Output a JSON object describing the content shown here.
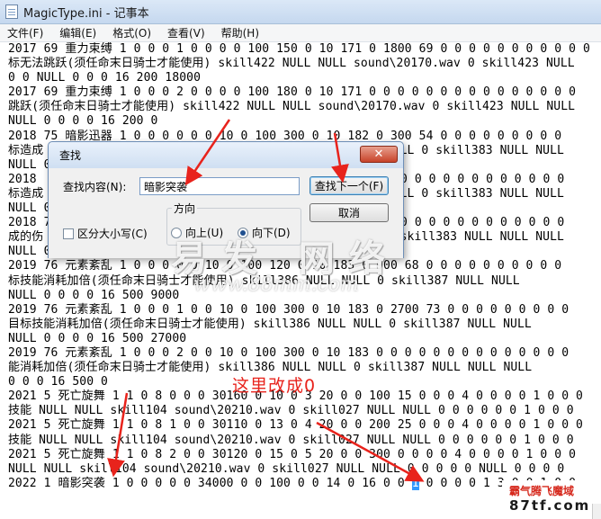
{
  "window": {
    "title": "MagicType.ini - 记事本"
  },
  "menu": [
    {
      "label": "文件(F)"
    },
    {
      "label": "编辑(E)"
    },
    {
      "label": "格式(O)"
    },
    {
      "label": "查看(V)"
    },
    {
      "label": "帮助(H)"
    }
  ],
  "editor": {
    "lines": [
      "2017 69 重力束缚 1 0 0 0 1 0 0 0 0 100 150 0 10 171 0 1800 69 0 0 0 0 0 0 0 0 0 0 0",
      "标无法跳跃(须任命末日骑士才能使用) skill422 NULL NULL sound\\20170.wav 0 skill423 NULL",
      "0 0 NULL 0 0 0 16 200 18000",
      "2017 69 重力束缚 1 0 0 0 2 0 0 0 0 100 180 0 10 171 0 0 0 0 0 0 0 0 0 0 0 0 0 0 0",
      "跳跃(须任命末日骑士才能使用) skill422 NULL NULL sound\\20170.wav 0 skill423 NULL NULL",
      "NULL 0 0 0 0 16 200 0",
      "2018 75 暗影迅器 1 0 0 0 0 0 0 10 0 100 300 0 10 182 0 300 54 0 0 0 0 0 0 0 0 0",
      "标造成                                           NULL NULL 0 skill383 NULL NULL",
      "NULL 0",
      "2018                                             1500 60 0 0 0 0 0 0 0 0 0 0 0",
      "标造成                                           NULL NULL 0 skill383 NULL NULL",
      "NULL 0",
      "2018 7                                           0 0 0 0 0 0 0 0 0 0 0 0 0 0 0",
      "成的伤                                           NULL 0 skill383 NULL NULL NULL",
      "NULL 0 0 0 0 16 200 0",
      "2019 76 元素紊乱 1 0 0 0 0 0 10 0 100 120 0 10 183 0 900 68 0 0 0 0 0 0 0 0 0 0",
      "标技能消耗加倍(须任命末日骑士才能使用) skill386 NULL NULL 0 skill387 NULL NULL",
      "NULL 0 0 0 0 16 500 9000",
      "2019 76 元素紊乱 1 0 0 0 1 0 0 10 0 100 300 0 10 183 0 2700 73 0 0 0 0 0 0 0 0 0",
      "目标技能消耗加倍(须任命末日骑士才能使用) skill386 NULL NULL 0 skill387 NULL NULL",
      "NULL 0 0 0 0 16 500 27000",
      "2019 76 元素紊乱 1 0 0 0 2 0 0 10 0 100 300 0 10 183 0 0 0 0 0 0 0 0 0 0 0 0 0 0",
      "能消耗加倍(须任命末日骑士才能使用) skill386 NULL NULL 0 skill387 NULL NULL NULL",
      "0 0 0 16 500 0",
      "2021 5 死亡旋舞 1 1 0 8 0 0 0 30160 0 10 0 3 20 0 0 100 15 0 0 0 4 0 0 0 0 1 0 0 0",
      "技能 NULL NULL skill104 sound\\20210.wav 0 skill027 NULL NULL 0 0 0 0 0 0 1 0 0 0",
      "2021 5 死亡旋舞 1 1 0 8 1 0 0 30110 0 13 0 4 20 0 0 200 25 0 0 0 4 0 0 0 0 1 0 0 0",
      "技能 NULL NULL skill104 sound\\20210.wav 0 skill027 NULL NULL 0 0 0 0 0 0 1 0 0 0",
      "2021 5 死亡旋舞 1 1 0 8 2 0 0 30120 0 15 0 5 20 0 0 300 0 0 0 0 4 0 0 0 0 1 0 0 0",
      "NULL NULL skill104 sound\\20210.wav 0 skill027 NULL NULL 0 0 0 0 0 NULL 0 0 0 0"
    ],
    "last_line_before": "2022 1 暗影突袭 1 0 0 0 0 0 34000 0 0 100 0 0 14 0 16 0 0 ",
    "last_line_selected": "1",
    "last_line_after": " 0 0 0 0 1 3 0 0 1 0 0"
  },
  "find_dialog": {
    "title": "查找",
    "close_glyph": "✕",
    "find_label": "查找内容(N):",
    "find_value": "暗影突袭",
    "find_next_label": "查找下一个(F)",
    "cancel_label": "取消",
    "direction_label": "方向",
    "up_label": "向上(U)",
    "down_label": "向下(D)",
    "match_case_label": "区分大小写(C)"
  },
  "annotation": {
    "text": "这里改成0"
  },
  "watermark": {
    "main": "易发 网络",
    "url": "www.88mm.com"
  },
  "corner_logo": {
    "line1": "霸气腾飞魔域",
    "line2": "87tf.com"
  },
  "colors": {
    "selection": "#3399ff",
    "annotation_red": "#e8231c"
  }
}
